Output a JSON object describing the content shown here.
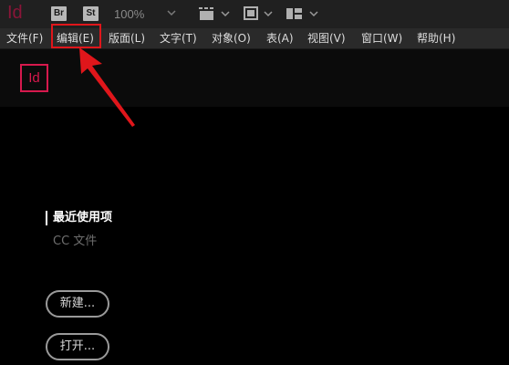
{
  "app_bar": {
    "logo": "Id",
    "bridge_badge": "Br",
    "stock_badge": "St",
    "zoom": "100%",
    "icons": [
      "screen-mode-icon",
      "view-options-icon",
      "arrange-documents-icon"
    ]
  },
  "menubar": {
    "items": [
      {
        "label": "文件(F)"
      },
      {
        "label": "编辑(E)"
      },
      {
        "label": "版面(L)"
      },
      {
        "label": "文字(T)"
      },
      {
        "label": "对象(O)"
      },
      {
        "label": "表(A)"
      },
      {
        "label": "视图(V)"
      },
      {
        "label": "窗口(W)"
      },
      {
        "label": "帮助(H)"
      }
    ],
    "highlighted_item": "编辑(E)"
  },
  "header": {
    "logo_text": "Id"
  },
  "start_screen": {
    "recent_heading": "最近使用项",
    "cc_files": "CC 文件",
    "new_button": "新建...",
    "open_button": "打开..."
  },
  "colors": {
    "annotation": "#e0161b",
    "brand": "#d6194d",
    "background": "#000000"
  }
}
